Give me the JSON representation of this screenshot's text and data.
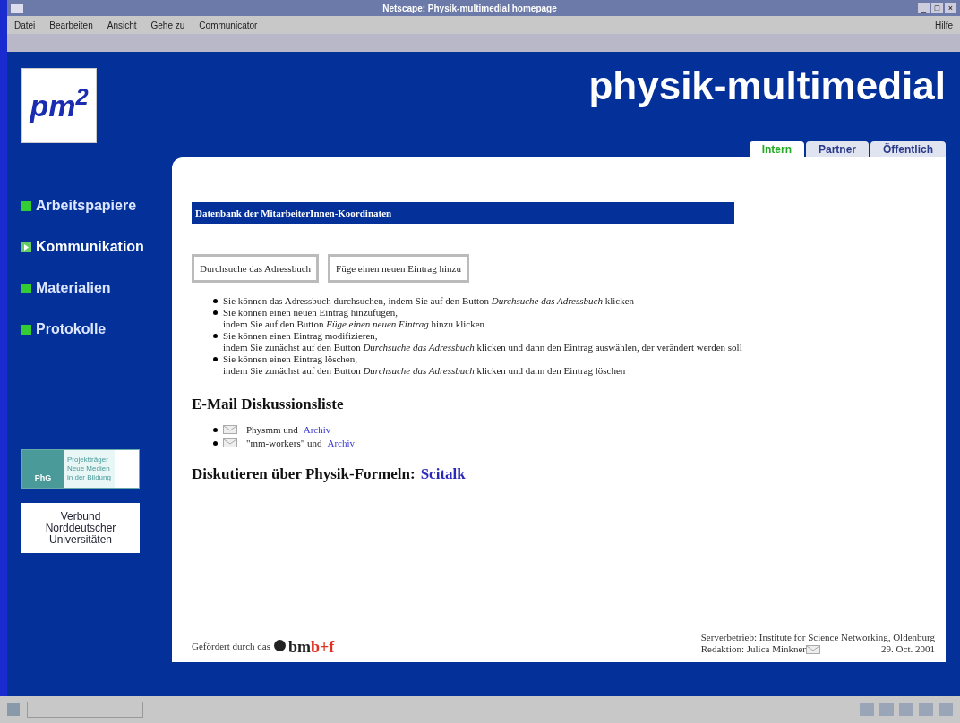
{
  "window": {
    "title": "Netscape: Physik-multimedial homepage",
    "controls": [
      "_",
      "□",
      "×"
    ]
  },
  "menu": [
    "Datei",
    "Bearbeiten",
    "Ansicht",
    "Gehe zu",
    "Communicator",
    "Hilfe"
  ],
  "logo": {
    "text": "pm$^{2}$"
  },
  "site_title": "physik-multimedial",
  "tabs": [
    {
      "label": "Intern",
      "selected": true
    },
    {
      "label": "Partner",
      "selected": false
    },
    {
      "label": "Öffentlich",
      "selected": false
    }
  ],
  "sidebar": {
    "items": [
      {
        "label": "Arbeitspapiere",
        "selected": false
      },
      {
        "label": "Kommunikation",
        "selected": true
      },
      {
        "label": "Materialien",
        "selected": false
      },
      {
        "label": "Protokolle",
        "selected": false
      }
    ],
    "badges": [
      {
        "kind": "phg",
        "short": "PhG",
        "lines": [
          "Projektträger",
          "Neue Medien",
          "in der Bildung"
        ]
      },
      {
        "kind": "vnu",
        "lines": [
          "Verbund",
          "Norddeutscher",
          "Universitäten"
        ]
      }
    ]
  },
  "content": {
    "banner": "Datenbank der MitarbeiterInnen-Koordinaten",
    "buttons": [
      "Durchsuche das Adressbuch",
      "Füge einen neuen Eintrag hinzu"
    ],
    "instructions": [
      {
        "lines": [
          "Sie können das Adressbuch durchsuchen, indem Sie auf den Button *Durchsuche das Adressbuch* klicken"
        ]
      },
      {
        "lines": [
          "Sie können einen neuen Eintrag hinzufügen,",
          "indem Sie auf den Button *Füge einen neuen Eintrag* hinzu klicken"
        ]
      },
      {
        "lines": [
          "Sie können einen Eintrag modifizieren,",
          "indem Sie zunächst auf den Button *Durchsuche das Adressbuch* klicken und dann den Eintrag auswählen, der verändert werden soll"
        ]
      },
      {
        "lines": [
          "Sie können einen Eintrag löschen,",
          "indem Sie zunächst auf den Button *Durchsuche das Adressbuch* klicken und dann den Eintrag löschen"
        ]
      }
    ],
    "mail_heading": "E-Mail Diskussionsliste",
    "mail_lists": [
      {
        "text": "Physmm und",
        "link": "Archiv"
      },
      {
        "text": "\"mm-workers\" und",
        "link": "Archiv"
      }
    ],
    "formula_heading": "Diskutieren über Physik-Formeln:",
    "formula_link": "Scitalk",
    "footer": {
      "funded": "Gefördert durch das",
      "sponsor_a": "bm",
      "sponsor_b": "b+f",
      "server": "Serverbetrieb: Institute for Science Networking, Oldenburg",
      "editor": "Redaktion: Julica Minkner",
      "date": "29. Oct. 2001"
    }
  }
}
